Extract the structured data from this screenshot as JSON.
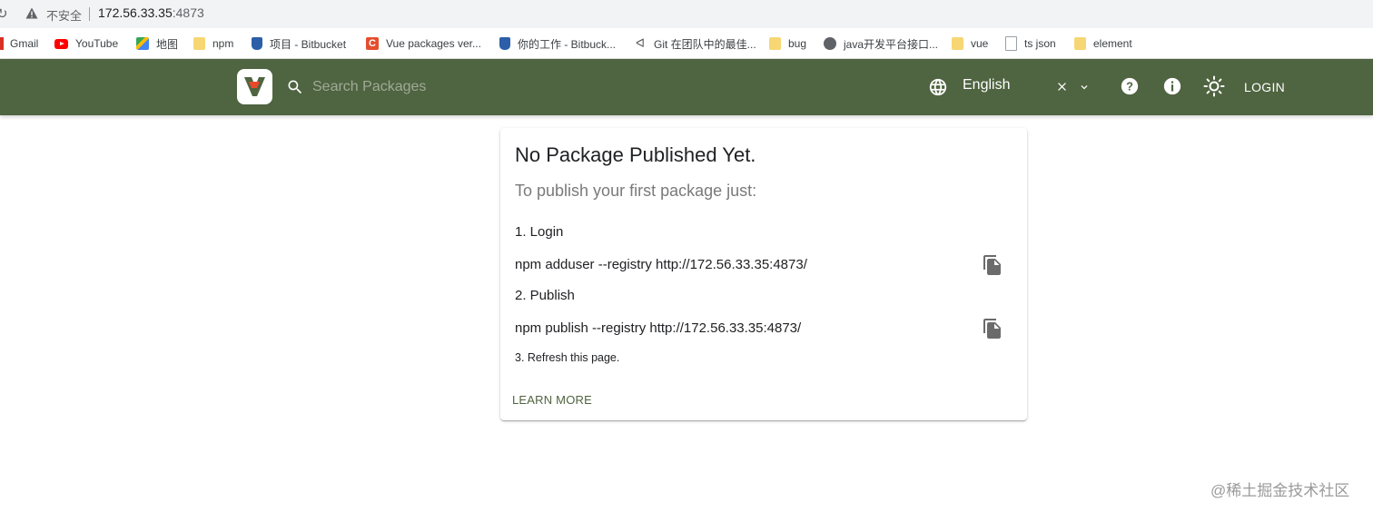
{
  "browser": {
    "security_label": "不安全",
    "url_host": "172.56.33.35",
    "url_port": ":4873",
    "bookmarks": [
      {
        "label": "Gmail",
        "icon": "gmail-icon"
      },
      {
        "label": "YouTube",
        "icon": "youtube-icon"
      },
      {
        "label": "地图",
        "icon": "maps-icon"
      },
      {
        "label": "npm",
        "icon": "folder-icon"
      },
      {
        "label": "项目 - Bitbucket",
        "icon": "bitbucket-icon"
      },
      {
        "label": "Vue packages ver...",
        "icon": "c-icon"
      },
      {
        "label": "你的工作 - Bitbuck...",
        "icon": "bitbucket-icon"
      },
      {
        "label": "Git 在团队中的最佳...",
        "icon": "git-icon"
      },
      {
        "label": "bug",
        "icon": "folder-icon"
      },
      {
        "label": "java开发平台接口...",
        "icon": "globe-icon"
      },
      {
        "label": "vue",
        "icon": "folder-icon"
      },
      {
        "label": "ts json",
        "icon": "page-icon"
      },
      {
        "label": "element",
        "icon": "folder-icon"
      }
    ]
  },
  "header": {
    "search_placeholder": "Search Packages",
    "language": "English",
    "login_label": "LOGIN",
    "brand_color": "#4f6440"
  },
  "card": {
    "title": "No Package Published Yet.",
    "subtitle": "To publish your first package just:",
    "step1_label": "1. Login",
    "step1_command": "npm adduser --registry http://172.56.33.35:4873/",
    "step2_label": "2. Publish",
    "step2_command": "npm publish --registry http://172.56.33.35:4873/",
    "step3_label": "3. Refresh this page.",
    "learn_more_label": "LEARN MORE"
  },
  "watermark": "@稀土掘金技术社区"
}
